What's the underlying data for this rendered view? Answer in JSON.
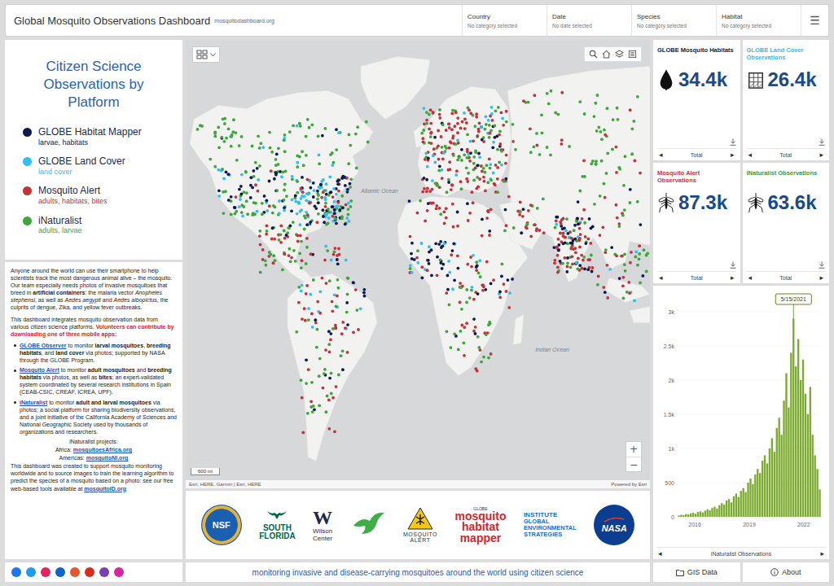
{
  "header": {
    "title": "Global Mosquito Observations Dashboard",
    "url": "mosquitodashboard.org",
    "filters": [
      {
        "label": "Country",
        "value": "No category selected"
      },
      {
        "label": "Date",
        "value": "No date selected"
      },
      {
        "label": "Species",
        "value": "No category selected"
      },
      {
        "label": "Habitat",
        "value": "No category selected"
      }
    ],
    "menu": "☰"
  },
  "legend": {
    "title": "Citizen Science Observations by Platform",
    "items": [
      {
        "name": "GLOBE Habitat Mapper",
        "sub": "larvae, habitats",
        "color": "#0d1b4f"
      },
      {
        "name": "GLOBE Land Cover",
        "sub": "land cover",
        "color": "#33bdf0"
      },
      {
        "name": "Mosquito Alert",
        "sub": "adults, habitats, bites",
        "color": "#c2333b"
      },
      {
        "name": "iNaturalist",
        "sub": "adults, larvae",
        "color": "#3ea63a"
      }
    ]
  },
  "about": [
    {
      "kind": "para",
      "segments": [
        {
          "kind": "plain",
          "text": "Anyone around the world can use their smartphone to help scientists track the most dangerous animal alive – the mosquito. Our team especially needs photos of invasive mosquitoes that breed in "
        },
        {
          "kind": "bold",
          "text": "artificial containers"
        },
        {
          "kind": "plain",
          "text": ": the malaria vector "
        },
        {
          "kind": "italic",
          "text": "Anopheles stephensi"
        },
        {
          "kind": "plain",
          "text": ", as well as "
        },
        {
          "kind": "italic",
          "text": "Aedes aegypti"
        },
        {
          "kind": "plain",
          "text": " and "
        },
        {
          "kind": "italic",
          "text": "Aedes albopictus"
        },
        {
          "kind": "plain",
          "text": ", the culprits of dengue, Zika, and yellow fever outbreaks."
        }
      ]
    },
    {
      "kind": "para",
      "segments": [
        {
          "kind": "plain",
          "text": "This dashboard integrates mosquito observation data from various citizen science platforms. "
        },
        {
          "kind": "red",
          "text": "Volunteers can contribute by downloading one of three mobile apps:"
        }
      ]
    },
    {
      "kind": "bullet",
      "segments": [
        {
          "kind": "link",
          "text": "GLOBE Observer"
        },
        {
          "kind": "plain",
          "text": " to monitor "
        },
        {
          "kind": "bold",
          "text": "larval mosquitoes"
        },
        {
          "kind": "plain",
          "text": ", "
        },
        {
          "kind": "bold",
          "text": "breeding habitats"
        },
        {
          "kind": "plain",
          "text": ", and "
        },
        {
          "kind": "bold",
          "text": "land cover"
        },
        {
          "kind": "plain",
          "text": " via photos; supported by NASA through the GLOBE Program."
        }
      ]
    },
    {
      "kind": "bullet",
      "segments": [
        {
          "kind": "link",
          "text": "Mosquito Alert"
        },
        {
          "kind": "plain",
          "text": " to monitor "
        },
        {
          "kind": "bold",
          "text": "adult mosquitoes"
        },
        {
          "kind": "plain",
          "text": " and "
        },
        {
          "kind": "bold",
          "text": "breeding habitats"
        },
        {
          "kind": "plain",
          "text": " via photos, as well as "
        },
        {
          "kind": "bold",
          "text": "bites"
        },
        {
          "kind": "plain",
          "text": "; an expert-validated system coordinated by several research institutions in Spain (CEAB-CSIC, CREAF, ICREA, UPF)."
        }
      ]
    },
    {
      "kind": "bullet",
      "segments": [
        {
          "kind": "link",
          "text": "iNaturalist"
        },
        {
          "kind": "plain",
          "text": " to monitor "
        },
        {
          "kind": "bold",
          "text": "adult and larval mosquitoes"
        },
        {
          "kind": "plain",
          "text": " via photos; a social platform for sharing biodiversity observations, and a joint initiative of the California Academy of Sciences and National Geographic Society used by thousands of organizations and researchers."
        }
      ]
    },
    {
      "kind": "center",
      "segments": [
        {
          "kind": "plain",
          "text": "iNaturalist projects:"
        }
      ]
    },
    {
      "kind": "center",
      "segments": [
        {
          "kind": "plain",
          "text": "Africa: "
        },
        {
          "kind": "link",
          "text": "mosquitoesAfrica.org"
        }
      ]
    },
    {
      "kind": "center",
      "segments": [
        {
          "kind": "plain",
          "text": "Americas: "
        },
        {
          "kind": "link",
          "text": "mosquitoNI.org"
        }
      ]
    },
    {
      "kind": "para",
      "segments": [
        {
          "kind": "plain",
          "text": "This dashboard was created to support mosquito monitoring worldwide and to source images to train the learning algorithm to predict the species of a mosquito based on a photo: see our free web-based tools available at "
        },
        {
          "kind": "link",
          "text": "mosquitoID.org"
        }
      ]
    }
  ],
  "social": [
    {
      "color": "#1877f2"
    },
    {
      "color": "#1d9bf0"
    },
    {
      "color": "#e0245e"
    },
    {
      "color": "#0a66c2"
    },
    {
      "color": "#e4572e"
    },
    {
      "color": "#d62d20"
    },
    {
      "color": "#7b3fb5"
    },
    {
      "color": "#d6249f"
    }
  ],
  "map": {
    "labels": [
      "Atlantic Ocean",
      "Indian Ocean"
    ],
    "zoom_in": "+",
    "zoom_out": "−",
    "scale": "600 mi",
    "attribution": "Esri, HERE, Garmin | Esri, HERE",
    "powered": "Powered by Esri"
  },
  "logos": [
    {
      "kind": "nsf",
      "lines": [
        "NSF"
      ]
    },
    {
      "kind": "usf",
      "lines": [
        "SOUTH",
        "FLORIDA"
      ]
    },
    {
      "kind": "wilson",
      "lines": [
        "W",
        "Wilson",
        "Center"
      ]
    },
    {
      "kind": "bird",
      "lines": []
    },
    {
      "kind": "alert",
      "lines": [
        "MOSQUITO",
        "ALERT"
      ]
    },
    {
      "kind": "mapper",
      "lines": [
        "GLOBE",
        "mosquito",
        "habitat",
        "mapper"
      ]
    },
    {
      "kind": "iges",
      "lines": [
        "INSTITUTE",
        "GLOBAL",
        "ENVIRONMENTAL",
        "STRATEGIES"
      ]
    },
    {
      "kind": "nasa",
      "lines": [
        "NASA"
      ]
    }
  ],
  "tagline": "monitoring invasive and disease-carrying mosquitoes around the world using citizen science",
  "stats": [
    {
      "title": "GLOBE Mosquito Habitats",
      "value": "34.4k",
      "color": "#1a2338",
      "kind": "habitat",
      "footer": "Total",
      "prev": "◂",
      "next": "▸"
    },
    {
      "title": "GLOBE Land Cover Observations",
      "value": "26.4k",
      "color": "#3bb8e8",
      "kind": "landcover",
      "footer": "Total",
      "prev": "◂",
      "next": "▸"
    },
    {
      "title": "Mosquito Alert Observations",
      "value": "87.3k",
      "color": "#c8323a",
      "kind": "mosquito",
      "footer": "Total",
      "prev": "◂",
      "next": "▸"
    },
    {
      "title": "iNaturalist Observations",
      "value": "63.6k",
      "color": "#3a9a35",
      "kind": "mosquito",
      "footer": "Total",
      "prev": "◂",
      "next": "▸"
    }
  ],
  "chart": {
    "values": [
      20,
      30,
      25,
      40,
      35,
      50,
      60,
      45,
      70,
      80,
      65,
      90,
      110,
      95,
      130,
      150,
      120,
      170,
      200,
      180,
      240,
      260,
      210,
      300,
      340,
      290,
      380,
      420,
      360,
      500,
      560,
      480,
      620,
      700,
      640,
      820,
      900,
      780,
      1000,
      1150,
      950,
      1300,
      1450,
      1200,
      1700,
      2100,
      1600,
      2400,
      2900,
      2200,
      2600,
      2000,
      2300,
      1800,
      1500,
      1900,
      1200,
      900,
      700,
      400
    ],
    "y_ticks": [
      "3k",
      "2.5k",
      "2k",
      "1.5k",
      "1k",
      "500",
      "0"
    ],
    "x_ticks": [
      "2016",
      "2019",
      "2022"
    ],
    "tooltip": "5/15/2021",
    "footer": "iNaturalist Observations",
    "prev": "◂",
    "next": "▸"
  },
  "buttons": [
    {
      "label": "GIS Data",
      "kind": "gis"
    },
    {
      "label": "About",
      "kind": "about"
    }
  ]
}
